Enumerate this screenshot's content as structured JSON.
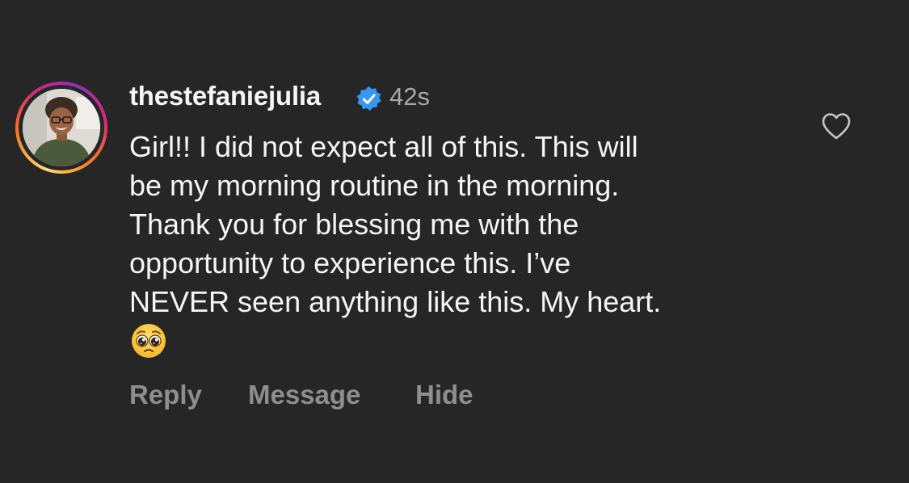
{
  "comment": {
    "username": "thestefaniejulia",
    "verified_icon": "verified-badge-icon",
    "timestamp": "42s",
    "text_lines": [
      "Girl!! I did not expect all of this. This will",
      "be my morning routine in the morning.",
      "Thank you for blessing me with the",
      "opportunity to experience this. I’ve",
      "NEVER seen anything like this. My heart."
    ],
    "emoji": "🥹",
    "like_icon": "heart-outline-icon",
    "actions": {
      "reply": "Reply",
      "message": "Message",
      "hide": "Hide"
    }
  },
  "colors": {
    "background": "#262626",
    "primary_text": "#f5f5f5",
    "secondary_text": "#a8a8a8",
    "action_text": "#8e8e8e",
    "verified_blue": "#3897f0"
  }
}
